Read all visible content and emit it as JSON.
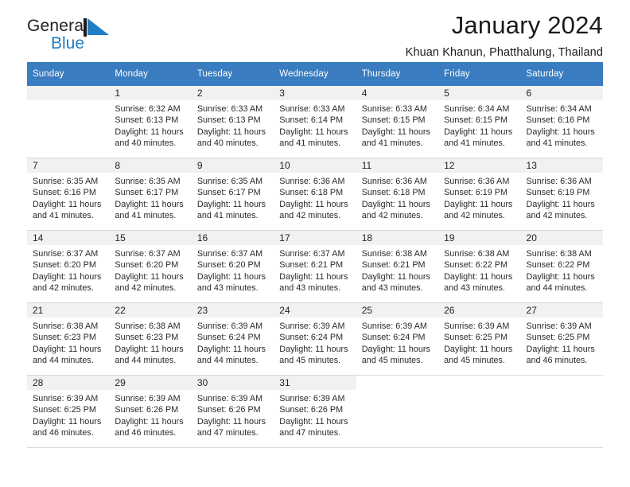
{
  "brand": {
    "name_top": "General",
    "name_bottom": "Blue",
    "mark": "triangle-logo",
    "color_top": "#231f20",
    "color_bottom": "#1f7dc2"
  },
  "header": {
    "title": "January 2024",
    "subtitle": "Khuan Khanun, Phatthalung, Thailand"
  },
  "theme": {
    "header_row_bg": "#3a7cc0",
    "daynum_bg": "#f1f1f1",
    "grid_line": "#d9d9d9",
    "text": "#222222"
  },
  "calendar": {
    "weekdays": [
      "Sunday",
      "Monday",
      "Tuesday",
      "Wednesday",
      "Thursday",
      "Friday",
      "Saturday"
    ],
    "labels": {
      "sunrise": "Sunrise:",
      "sunset": "Sunset:",
      "daylight": "Daylight:"
    },
    "weeks": [
      [
        {
          "day": "",
          "sunrise": "",
          "sunset": "",
          "daylight_line1": "",
          "daylight_line2": ""
        },
        {
          "day": "1",
          "sunrise": "Sunrise: 6:32 AM",
          "sunset": "Sunset: 6:13 PM",
          "daylight_line1": "Daylight: 11 hours",
          "daylight_line2": "and 40 minutes."
        },
        {
          "day": "2",
          "sunrise": "Sunrise: 6:33 AM",
          "sunset": "Sunset: 6:13 PM",
          "daylight_line1": "Daylight: 11 hours",
          "daylight_line2": "and 40 minutes."
        },
        {
          "day": "3",
          "sunrise": "Sunrise: 6:33 AM",
          "sunset": "Sunset: 6:14 PM",
          "daylight_line1": "Daylight: 11 hours",
          "daylight_line2": "and 41 minutes."
        },
        {
          "day": "4",
          "sunrise": "Sunrise: 6:33 AM",
          "sunset": "Sunset: 6:15 PM",
          "daylight_line1": "Daylight: 11 hours",
          "daylight_line2": "and 41 minutes."
        },
        {
          "day": "5",
          "sunrise": "Sunrise: 6:34 AM",
          "sunset": "Sunset: 6:15 PM",
          "daylight_line1": "Daylight: 11 hours",
          "daylight_line2": "and 41 minutes."
        },
        {
          "day": "6",
          "sunrise": "Sunrise: 6:34 AM",
          "sunset": "Sunset: 6:16 PM",
          "daylight_line1": "Daylight: 11 hours",
          "daylight_line2": "and 41 minutes."
        }
      ],
      [
        {
          "day": "7",
          "sunrise": "Sunrise: 6:35 AM",
          "sunset": "Sunset: 6:16 PM",
          "daylight_line1": "Daylight: 11 hours",
          "daylight_line2": "and 41 minutes."
        },
        {
          "day": "8",
          "sunrise": "Sunrise: 6:35 AM",
          "sunset": "Sunset: 6:17 PM",
          "daylight_line1": "Daylight: 11 hours",
          "daylight_line2": "and 41 minutes."
        },
        {
          "day": "9",
          "sunrise": "Sunrise: 6:35 AM",
          "sunset": "Sunset: 6:17 PM",
          "daylight_line1": "Daylight: 11 hours",
          "daylight_line2": "and 41 minutes."
        },
        {
          "day": "10",
          "sunrise": "Sunrise: 6:36 AM",
          "sunset": "Sunset: 6:18 PM",
          "daylight_line1": "Daylight: 11 hours",
          "daylight_line2": "and 42 minutes."
        },
        {
          "day": "11",
          "sunrise": "Sunrise: 6:36 AM",
          "sunset": "Sunset: 6:18 PM",
          "daylight_line1": "Daylight: 11 hours",
          "daylight_line2": "and 42 minutes."
        },
        {
          "day": "12",
          "sunrise": "Sunrise: 6:36 AM",
          "sunset": "Sunset: 6:19 PM",
          "daylight_line1": "Daylight: 11 hours",
          "daylight_line2": "and 42 minutes."
        },
        {
          "day": "13",
          "sunrise": "Sunrise: 6:36 AM",
          "sunset": "Sunset: 6:19 PM",
          "daylight_line1": "Daylight: 11 hours",
          "daylight_line2": "and 42 minutes."
        }
      ],
      [
        {
          "day": "14",
          "sunrise": "Sunrise: 6:37 AM",
          "sunset": "Sunset: 6:20 PM",
          "daylight_line1": "Daylight: 11 hours",
          "daylight_line2": "and 42 minutes."
        },
        {
          "day": "15",
          "sunrise": "Sunrise: 6:37 AM",
          "sunset": "Sunset: 6:20 PM",
          "daylight_line1": "Daylight: 11 hours",
          "daylight_line2": "and 42 minutes."
        },
        {
          "day": "16",
          "sunrise": "Sunrise: 6:37 AM",
          "sunset": "Sunset: 6:20 PM",
          "daylight_line1": "Daylight: 11 hours",
          "daylight_line2": "and 43 minutes."
        },
        {
          "day": "17",
          "sunrise": "Sunrise: 6:37 AM",
          "sunset": "Sunset: 6:21 PM",
          "daylight_line1": "Daylight: 11 hours",
          "daylight_line2": "and 43 minutes."
        },
        {
          "day": "18",
          "sunrise": "Sunrise: 6:38 AM",
          "sunset": "Sunset: 6:21 PM",
          "daylight_line1": "Daylight: 11 hours",
          "daylight_line2": "and 43 minutes."
        },
        {
          "day": "19",
          "sunrise": "Sunrise: 6:38 AM",
          "sunset": "Sunset: 6:22 PM",
          "daylight_line1": "Daylight: 11 hours",
          "daylight_line2": "and 43 minutes."
        },
        {
          "day": "20",
          "sunrise": "Sunrise: 6:38 AM",
          "sunset": "Sunset: 6:22 PM",
          "daylight_line1": "Daylight: 11 hours",
          "daylight_line2": "and 44 minutes."
        }
      ],
      [
        {
          "day": "21",
          "sunrise": "Sunrise: 6:38 AM",
          "sunset": "Sunset: 6:23 PM",
          "daylight_line1": "Daylight: 11 hours",
          "daylight_line2": "and 44 minutes."
        },
        {
          "day": "22",
          "sunrise": "Sunrise: 6:38 AM",
          "sunset": "Sunset: 6:23 PM",
          "daylight_line1": "Daylight: 11 hours",
          "daylight_line2": "and 44 minutes."
        },
        {
          "day": "23",
          "sunrise": "Sunrise: 6:39 AM",
          "sunset": "Sunset: 6:24 PM",
          "daylight_line1": "Daylight: 11 hours",
          "daylight_line2": "and 44 minutes."
        },
        {
          "day": "24",
          "sunrise": "Sunrise: 6:39 AM",
          "sunset": "Sunset: 6:24 PM",
          "daylight_line1": "Daylight: 11 hours",
          "daylight_line2": "and 45 minutes."
        },
        {
          "day": "25",
          "sunrise": "Sunrise: 6:39 AM",
          "sunset": "Sunset: 6:24 PM",
          "daylight_line1": "Daylight: 11 hours",
          "daylight_line2": "and 45 minutes."
        },
        {
          "day": "26",
          "sunrise": "Sunrise: 6:39 AM",
          "sunset": "Sunset: 6:25 PM",
          "daylight_line1": "Daylight: 11 hours",
          "daylight_line2": "and 45 minutes."
        },
        {
          "day": "27",
          "sunrise": "Sunrise: 6:39 AM",
          "sunset": "Sunset: 6:25 PM",
          "daylight_line1": "Daylight: 11 hours",
          "daylight_line2": "and 46 minutes."
        }
      ],
      [
        {
          "day": "28",
          "sunrise": "Sunrise: 6:39 AM",
          "sunset": "Sunset: 6:25 PM",
          "daylight_line1": "Daylight: 11 hours",
          "daylight_line2": "and 46 minutes."
        },
        {
          "day": "29",
          "sunrise": "Sunrise: 6:39 AM",
          "sunset": "Sunset: 6:26 PM",
          "daylight_line1": "Daylight: 11 hours",
          "daylight_line2": "and 46 minutes."
        },
        {
          "day": "30",
          "sunrise": "Sunrise: 6:39 AM",
          "sunset": "Sunset: 6:26 PM",
          "daylight_line1": "Daylight: 11 hours",
          "daylight_line2": "and 47 minutes."
        },
        {
          "day": "31",
          "sunrise": "Sunrise: 6:39 AM",
          "sunset": "Sunset: 6:26 PM",
          "daylight_line1": "Daylight: 11 hours",
          "daylight_line2": "and 47 minutes."
        },
        {
          "day": "",
          "sunrise": "",
          "sunset": "",
          "daylight_line1": "",
          "daylight_line2": ""
        },
        {
          "day": "",
          "sunrise": "",
          "sunset": "",
          "daylight_line1": "",
          "daylight_line2": ""
        },
        {
          "day": "",
          "sunrise": "",
          "sunset": "",
          "daylight_line1": "",
          "daylight_line2": ""
        }
      ]
    ]
  }
}
